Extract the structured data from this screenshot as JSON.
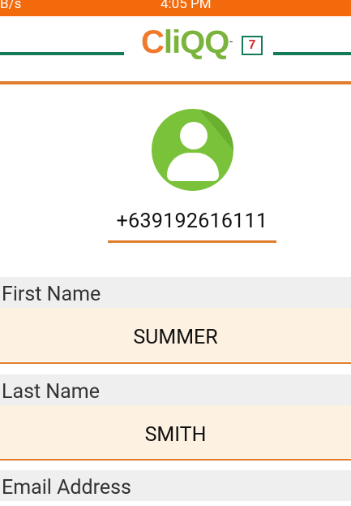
{
  "status": {
    "left": "B/s",
    "time": "4:05 PM"
  },
  "header": {
    "logo_c": "C",
    "logo_rest": "liQQ",
    "separator": "-",
    "partner_badge": "7"
  },
  "profile": {
    "phone": "+639192616111"
  },
  "fields": [
    {
      "label": "First Name",
      "value": "SUMMER"
    },
    {
      "label": "Last Name",
      "value": "SMITH"
    },
    {
      "label": "Email Address",
      "value": ""
    }
  ],
  "colors": {
    "status_bar": "#f26a0c",
    "accent": "#e07d2d",
    "brand_green": "#157a56",
    "avatar": "#79c23a",
    "field_bg": "#fdf1e2"
  }
}
